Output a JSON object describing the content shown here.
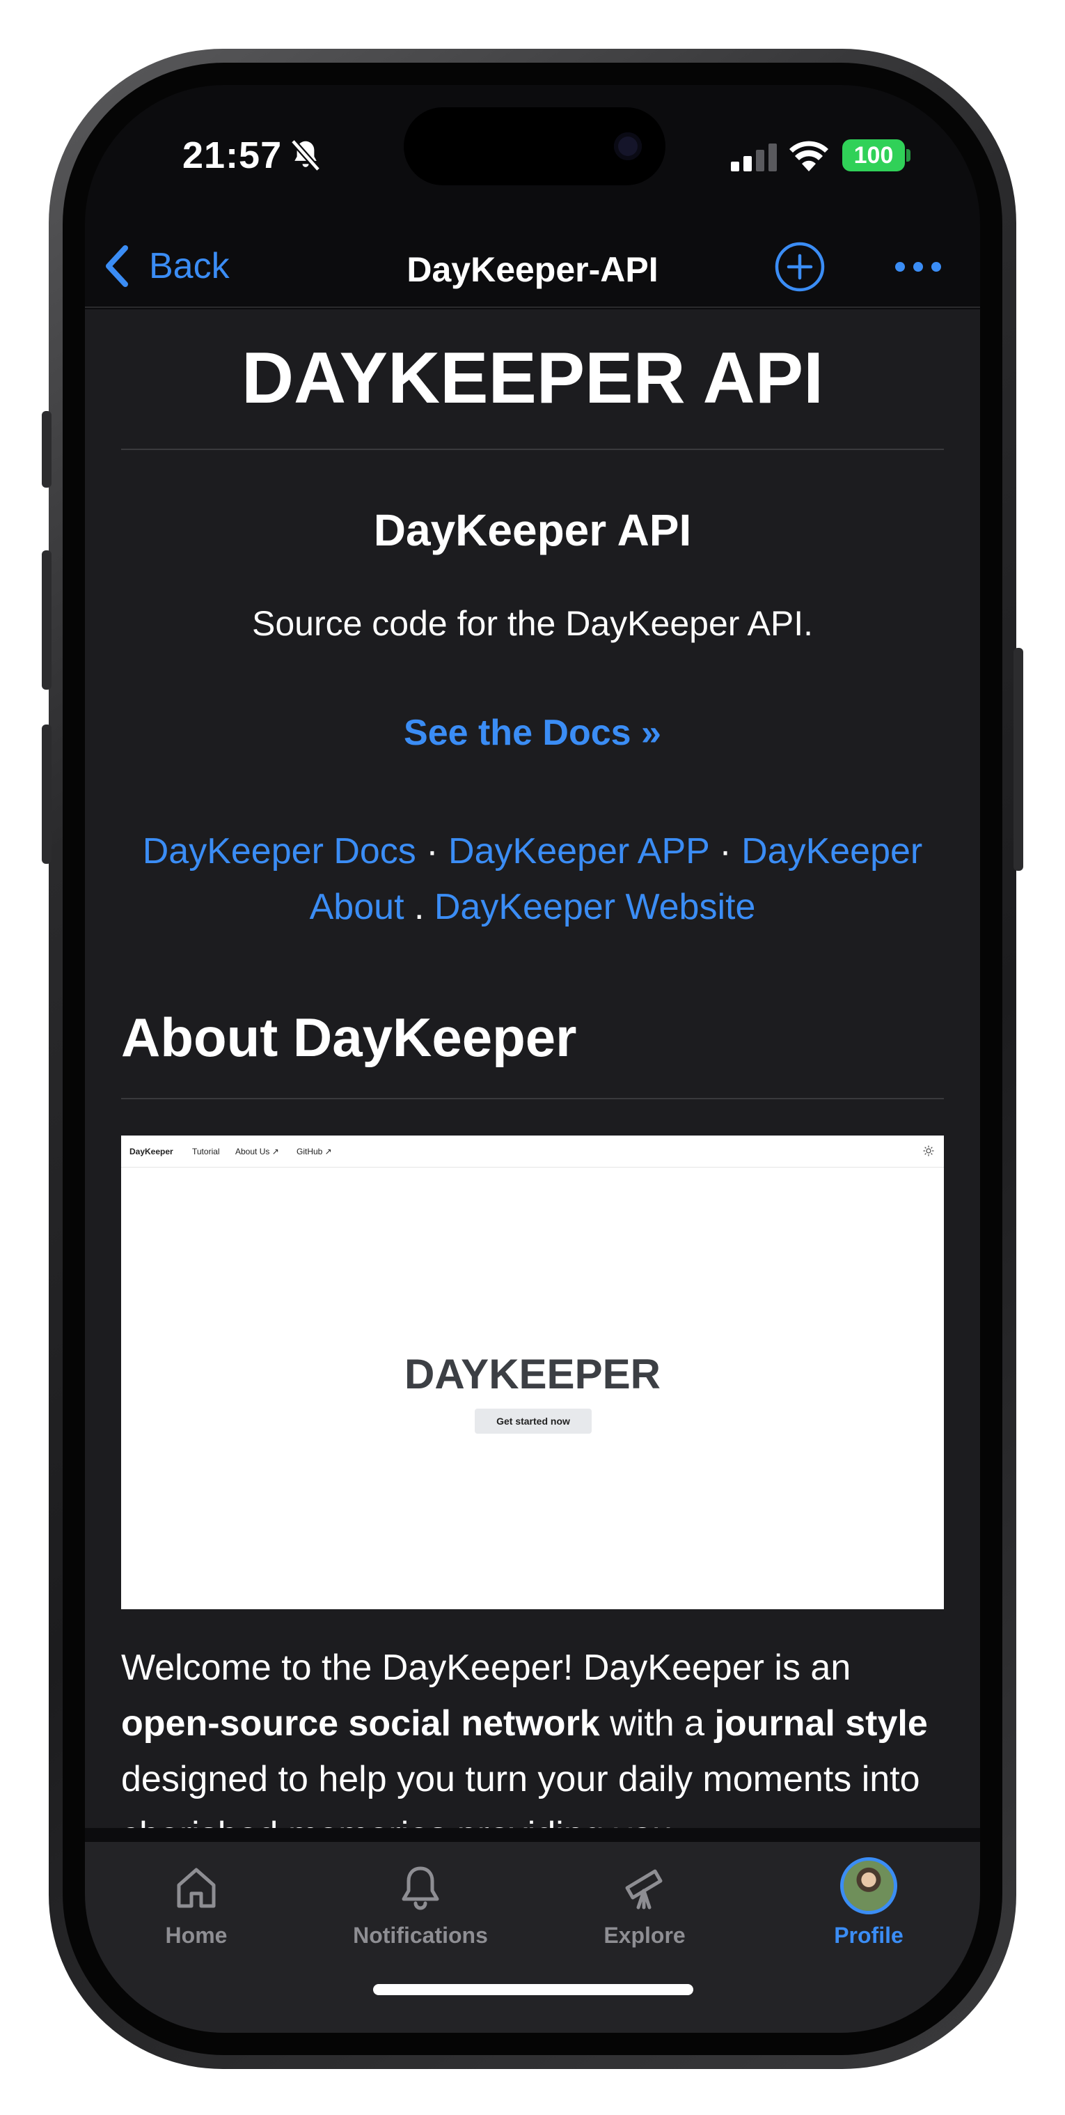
{
  "status": {
    "time": "21:57",
    "battery": "100"
  },
  "nav": {
    "back_label": "Back",
    "title": "DayKeeper-API"
  },
  "readme": {
    "heading": "DAYKEEPER API",
    "subheading": "DayKeeper API",
    "subtitle": "Source code for the DayKeeper API.",
    "docs_link": "See the Docs »",
    "links": [
      {
        "label": "DayKeeper Docs",
        "sep": " · "
      },
      {
        "label": "DayKeeper APP",
        "sep": " · "
      },
      {
        "label": "DayKeeper About",
        "sep": " . "
      },
      {
        "label": "DayKeeper Website",
        "sep": ""
      }
    ],
    "about_heading": "About DayKeeper",
    "preview": {
      "brand": "DayKeeper",
      "nav_tutorial": "Tutorial",
      "nav_about": "About Us ↗",
      "nav_github": "GitHub ↗",
      "title": "DAYKEEPER",
      "button": "Get started now"
    },
    "paragraph": {
      "p1": "Welcome to the DayKeeper! DayKeeper is an ",
      "b1": "open-source social network",
      "p2": " with a ",
      "b2": "journal style",
      "p3": " designed to help you turn your daily moments into cherished memories providing you"
    }
  },
  "tabs": [
    {
      "label": "Home",
      "icon": "home-icon"
    },
    {
      "label": "Notifications",
      "icon": "bell-icon"
    },
    {
      "label": "Explore",
      "icon": "telescope-icon"
    },
    {
      "label": "Profile",
      "icon": "avatar"
    }
  ],
  "colors": {
    "accent": "#3b8df5",
    "background": "#1c1c1f",
    "battery": "#30d158"
  }
}
